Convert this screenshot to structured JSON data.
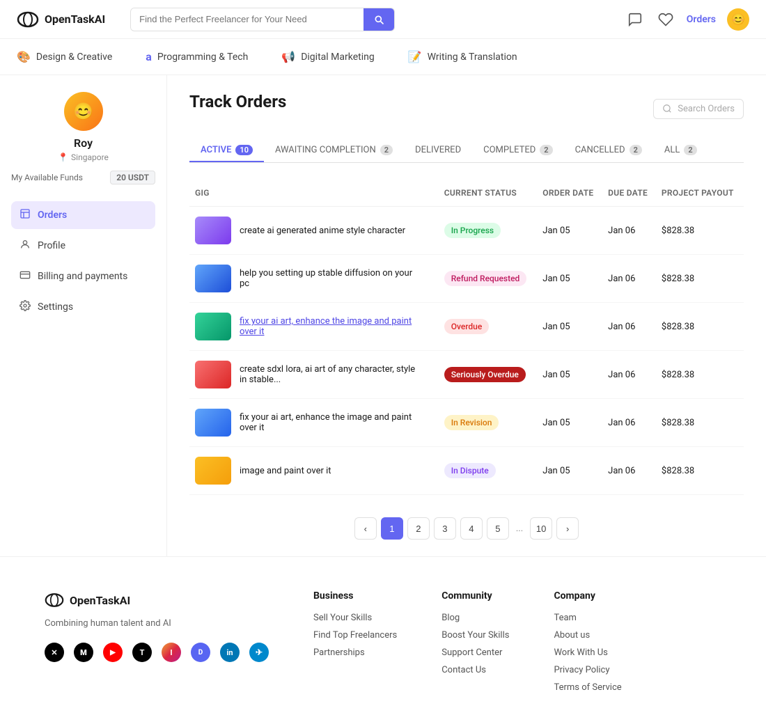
{
  "header": {
    "logo": "OpenTaskAI",
    "search_placeholder": "Find the Perfect Freelancer for Your Need",
    "orders_link": "Orders"
  },
  "nav": {
    "items": [
      {
        "id": "design",
        "icon": "🎨",
        "label": "Design & Creative"
      },
      {
        "id": "programming",
        "icon": "a",
        "label": "Programming & Tech"
      },
      {
        "id": "marketing",
        "icon": "📢",
        "label": "Digital Marketing"
      },
      {
        "id": "writing",
        "icon": "📝",
        "label": "Writing & Translation"
      }
    ]
  },
  "sidebar": {
    "user": {
      "name": "Roy",
      "location": "Singapore",
      "funds_label": "My Available Funds",
      "funds_value": "20 USDT"
    },
    "menu": [
      {
        "id": "orders",
        "icon": "☰",
        "label": "Orders",
        "active": true
      },
      {
        "id": "profile",
        "icon": "👤",
        "label": "Profile",
        "active": false
      },
      {
        "id": "billing",
        "icon": "💳",
        "label": "Billing and payments",
        "active": false
      },
      {
        "id": "settings",
        "icon": "⚙",
        "label": "Settings",
        "active": false
      }
    ]
  },
  "track_orders": {
    "title": "Track Orders",
    "search_placeholder": "Search Orders",
    "tabs": [
      {
        "id": "active",
        "label": "ACTIVE",
        "badge": "10",
        "badge_type": "purple",
        "active": true
      },
      {
        "id": "awaiting",
        "label": "AWAITING COMPLETION",
        "badge": "2",
        "badge_type": "gray",
        "active": false
      },
      {
        "id": "delivered",
        "label": "DELIVERED",
        "badge": null,
        "active": false
      },
      {
        "id": "completed",
        "label": "COMPLETED",
        "badge": "2",
        "badge_type": "gray",
        "active": false
      },
      {
        "id": "cancelled",
        "label": "CANCELLED",
        "badge": "2",
        "badge_type": "gray",
        "active": false
      },
      {
        "id": "all",
        "label": "ALL",
        "badge": "2",
        "badge_type": "gray",
        "active": false
      }
    ],
    "table": {
      "columns": [
        "GIG",
        "Current Status",
        "Order Date",
        "Due Date",
        "Project Payout"
      ],
      "rows": [
        {
          "id": 1,
          "title": "create ai generated anime style character",
          "link": false,
          "status": "In Progress",
          "status_type": "in-progress",
          "order_date": "Jan 05",
          "due_date": "Jan 06",
          "payout": "$828.38",
          "thumb": "thumb-1"
        },
        {
          "id": 2,
          "title": "help you setting up stable diffusion on your pc",
          "link": false,
          "status": "Refund Requested",
          "status_type": "refund",
          "order_date": "Jan 05",
          "due_date": "Jan 06",
          "payout": "$828.38",
          "thumb": "thumb-2"
        },
        {
          "id": 3,
          "title": "fix your ai art, enhance the image and paint over it",
          "link": true,
          "status": "Overdue",
          "status_type": "overdue",
          "order_date": "Jan 05",
          "due_date": "Jan 06",
          "payout": "$828.38",
          "thumb": "thumb-3"
        },
        {
          "id": 4,
          "title": "create sdxl lora, ai art of any character, style in stable...",
          "link": false,
          "status": "Seriously Overdue",
          "status_type": "seriously-overdue",
          "order_date": "Jan 05",
          "due_date": "Jan 06",
          "payout": "$828.38",
          "thumb": "thumb-4"
        },
        {
          "id": 5,
          "title": "fix your ai art, enhance the image and paint over it",
          "link": false,
          "status": "In Revision",
          "status_type": "revision",
          "order_date": "Jan 05",
          "due_date": "Jan 06",
          "payout": "$828.38",
          "thumb": "thumb-5"
        },
        {
          "id": 6,
          "title": "image and paint over it",
          "link": false,
          "status": "In Dispute",
          "status_type": "dispute",
          "order_date": "Jan 05",
          "due_date": "Jan 06",
          "payout": "$828.38",
          "thumb": "thumb-6"
        }
      ]
    },
    "pagination": {
      "prev": "‹",
      "next": "›",
      "pages": [
        "1",
        "2",
        "3",
        "4",
        "5",
        "...",
        "10"
      ],
      "active_page": "1"
    }
  },
  "footer": {
    "logo": "OpenTaskAI",
    "tagline": "Combining human talent and AI",
    "social": [
      {
        "id": "twitter",
        "label": "X"
      },
      {
        "id": "medium",
        "label": "M"
      },
      {
        "id": "youtube",
        "label": "▶"
      },
      {
        "id": "tiktok",
        "label": "T"
      },
      {
        "id": "instagram",
        "label": "I"
      },
      {
        "id": "discord",
        "label": "D"
      },
      {
        "id": "linkedin",
        "label": "in"
      },
      {
        "id": "telegram",
        "label": "✈"
      }
    ],
    "columns": [
      {
        "id": "business",
        "heading": "Business",
        "links": [
          "Sell Your Skills",
          "Find Top Freelancers",
          "Partnerships"
        ]
      },
      {
        "id": "community",
        "heading": "Community",
        "links": [
          "Blog",
          "Boost Your Skills",
          "Support Center",
          "Contact Us"
        ]
      },
      {
        "id": "company",
        "heading": "Company",
        "links": [
          "Team",
          "About us",
          "Work With Us",
          "Privacy Policy",
          "Terms of Service"
        ]
      }
    ]
  }
}
